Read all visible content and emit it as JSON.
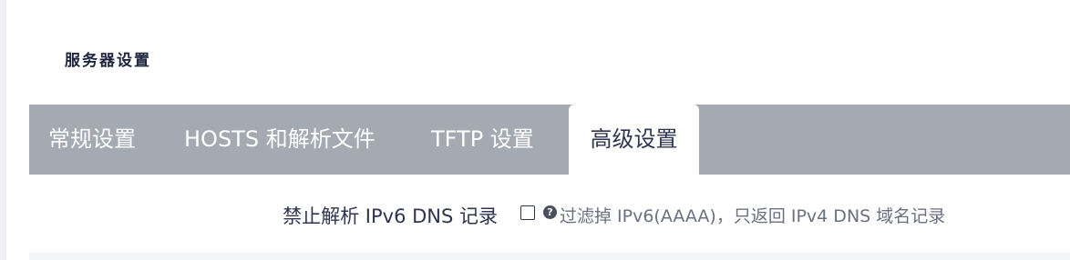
{
  "section": {
    "title": "服务器设置"
  },
  "tabs": [
    {
      "label": "常规设置",
      "active": false
    },
    {
      "label": "HOSTS 和解析文件",
      "active": false
    },
    {
      "label": "TFTP 设置",
      "active": false
    },
    {
      "label": "高级设置",
      "active": true
    }
  ],
  "settings": {
    "disable_ipv6": {
      "label": "禁止解析 IPv6 DNS 记录",
      "checked": false,
      "help_icon": "question-circle-icon",
      "help": "过滤掉 IPv6(AAAA)，只返回 IPv4 DNS 域名记录"
    }
  },
  "colors": {
    "tabbar_bg": "#a4a9b2",
    "active_tab_text": "#2f3550",
    "label_text": "#2f3550",
    "help_text": "#6b7080"
  }
}
